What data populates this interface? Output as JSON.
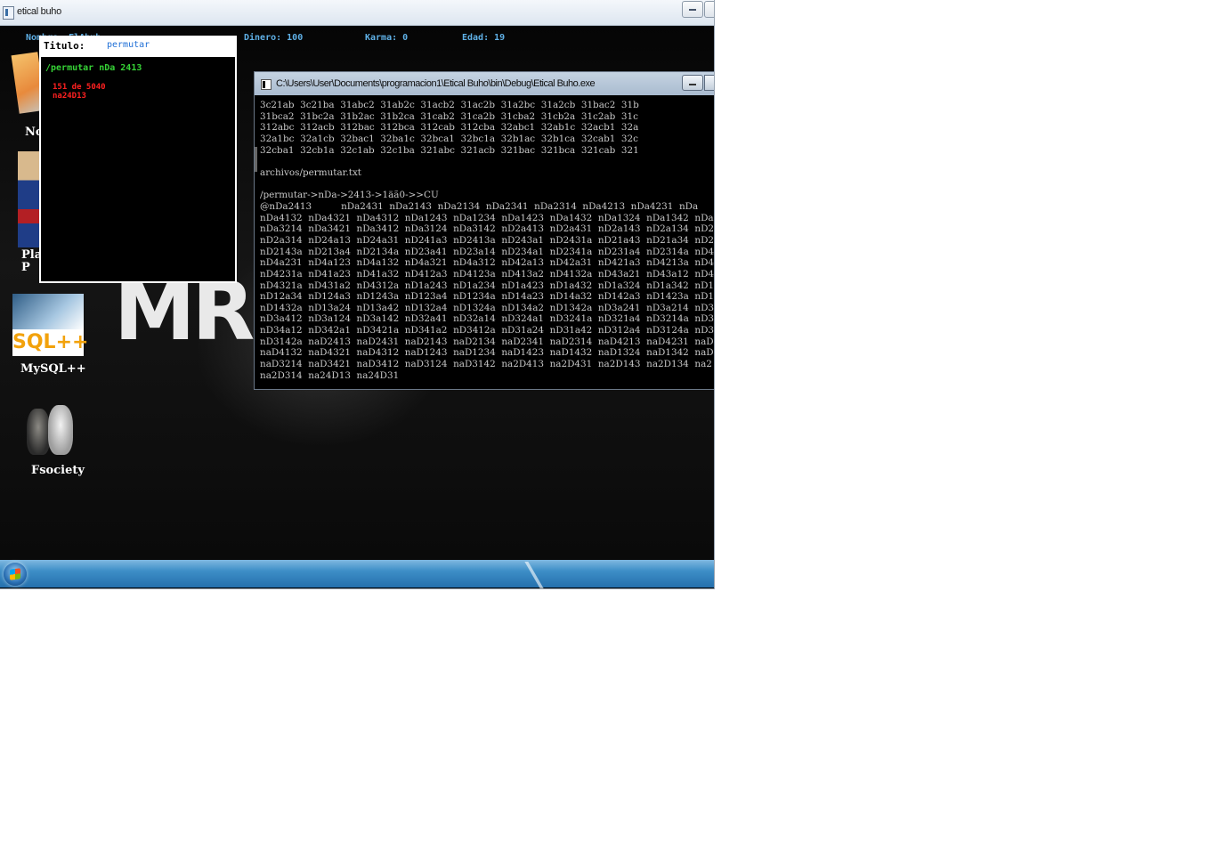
{
  "window": {
    "title": "etical buho"
  },
  "stats": {
    "nombre": "Nombre: ElAbuh",
    "dinero": "Dinero: 100",
    "karma": "Karma: 0",
    "edad": "Edad: 19"
  },
  "desktop": {
    "banner_text": "MR.",
    "icons": [
      {
        "label": "No",
        "icon": "notepad-icon"
      },
      {
        "label": "Pla\nP",
        "icon": "planet-icon"
      },
      {
        "label": "MySQL++",
        "icon": "sql-icon",
        "image_text": "SQL++"
      },
      {
        "label": "Fsociety",
        "icon": "fsociety-mask-icon"
      }
    ]
  },
  "popup": {
    "title_label": "Titulo:",
    "title_value": "permutar",
    "command": "/permutar nDa 2413",
    "count": "151 de 5040",
    "current": "na24D13"
  },
  "console": {
    "title": "C:\\Users\\User\\Documents\\programacion1\\Etical Buho\\bin\\Debug\\Etical Buho.exe",
    "lines": [
      "3c21ab  3c21ba  31abc2  31ab2c  31acb2  31ac2b  31a2bc  31a2cb  31bac2  31b",
      "31bca2  31bc2a  31b2ac  31b2ca  31cab2  31ca2b  31cba2  31cb2a  31c2ab  31c",
      "312abc  312acb  312bac  312bca  312cab  312cba  32abc1  32ab1c  32acb1  32a",
      "32a1bc  32a1cb  32bac1  32ba1c  32bca1  32bc1a  32b1ac  32b1ca  32cab1  32c",
      "32cba1  32cb1a  32c1ab  32c1ba  321abc  321acb  321bac  321bca  321cab  321",
      "",
      "archivos/permutar.txt",
      "",
      "/permutar->nDa->2413->1äã0->>CU",
      "@nDa2413          nDa2431  nDa2143  nDa2134  nDa2341  nDa2314  nDa4213  nDa4231  nDa",
      "nDa4132  nDa4321  nDa4312  nDa1243  nDa1234  nDa1423  nDa1432  nDa1324  nDa1342  nDa",
      "nDa3214  nDa3421  nDa3412  nDa3124  nDa3142  nD2a413  nD2a431  nD2a143  nD2a134  nD2",
      "nD2a314  nD24a13  nD24a31  nD241a3  nD2413a  nD243a1  nD2431a  nD21a43  nD21a34  nD2",
      "nD2143a  nD213a4  nD2134a  nD23a41  nD23a14  nD234a1  nD2341a  nD231a4  nD2314a  nD4",
      "nD4a231  nD4a123  nD4a132  nD4a321  nD4a312  nD42a13  nD42a31  nD421a3  nD4213a  nD4",
      "nD4231a  nD41a23  nD41a32  nD412a3  nD4123a  nD413a2  nD4132a  nD43a21  nD43a12  nD4",
      "nD4321a  nD431a2  nD4312a  nD1a243  nD1a234  nD1a423  nD1a432  nD1a324  nD1a342  nD1",
      "nD12a34  nD124a3  nD1243a  nD123a4  nD1234a  nD14a23  nD14a32  nD142a3  nD1423a  nD1",
      "nD1432a  nD13a24  nD13a42  nD132a4  nD1324a  nD134a2  nD1342a  nD3a241  nD3a214  nD3",
      "nD3a412  nD3a124  nD3a142  nD32a41  nD32a14  nD324a1  nD3241a  nD321a4  nD3214a  nD3",
      "nD34a12  nD342a1  nD3421a  nD341a2  nD3412a  nD31a24  nD31a42  nD312a4  nD3124a  nD3",
      "nD3142a  naD2413  naD2431  naD2143  naD2134  naD2341  naD2314  naD4213  naD4231  naD",
      "naD4132  naD4321  naD4312  naD1243  naD1234  naD1423  naD1432  naD1324  naD1342  naD",
      "naD3214  naD3421  naD3412  naD3124  naD3142  na2D413  na2D431  na2D143  na2D134  na2",
      "na2D314  na24D13  na24D31"
    ]
  },
  "colors": {
    "stat_text": "#5fb0e6",
    "popup_command": "#36d236",
    "popup_count": "#ff2020",
    "console_text": "#c8c8c8",
    "taskbar": "#2570ad"
  }
}
